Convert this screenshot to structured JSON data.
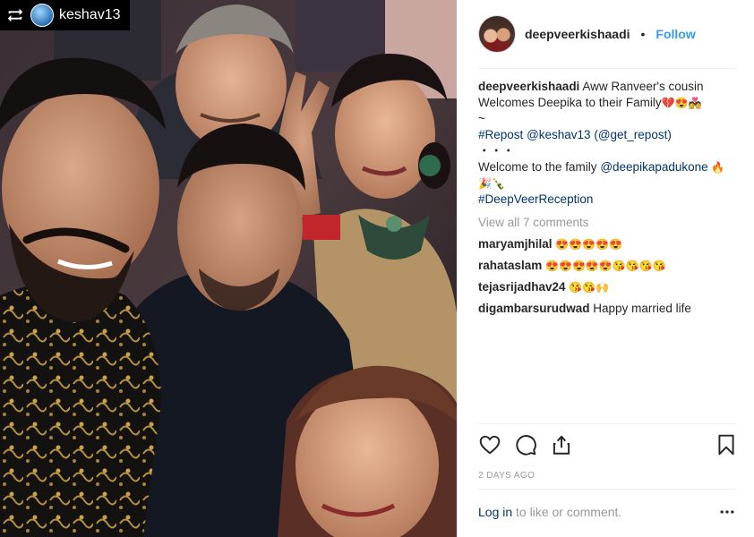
{
  "repost": {
    "username": "keshav13",
    "icon": "repost-icon"
  },
  "post": {
    "username": "deepveerkishaadi",
    "follow_label": "Follow",
    "separator": "•"
  },
  "caption": {
    "username": "deepveerkishaadi",
    "text": "Aww Ranveer's cousin Welcomes Deepika to their Family",
    "emojis": "💔😍💑",
    "tilde": "~",
    "repost_hashtag": "#Repost",
    "repost_mention": "@keshav13",
    "repost_source": "(@get_repost)",
    "dots": "・・・",
    "welcome_text": "Welcome to the family",
    "welcome_mention": "@deepikapadukone",
    "welcome_emojis": "🔥🎉🍾",
    "hashtag": "#DeepVeerReception"
  },
  "view_all_comments": "View all 7 comments",
  "comments": [
    {
      "username": "maryamjhilal",
      "text": "😍😍😍😍😍"
    },
    {
      "username": "rahataslam",
      "text": "😍😍😍😍😍😘😘😘😘"
    },
    {
      "username": "tejasrijadhav24",
      "text": "😘😘🙌"
    },
    {
      "username": "digambarsurudwad",
      "text": "Happy married life"
    }
  ],
  "timestamp": "2 DAYS AGO",
  "login": {
    "link": "Log in",
    "rest": " to like or comment."
  },
  "colors": {
    "link": "#003569",
    "follow": "#3897f0",
    "muted": "#999999"
  }
}
